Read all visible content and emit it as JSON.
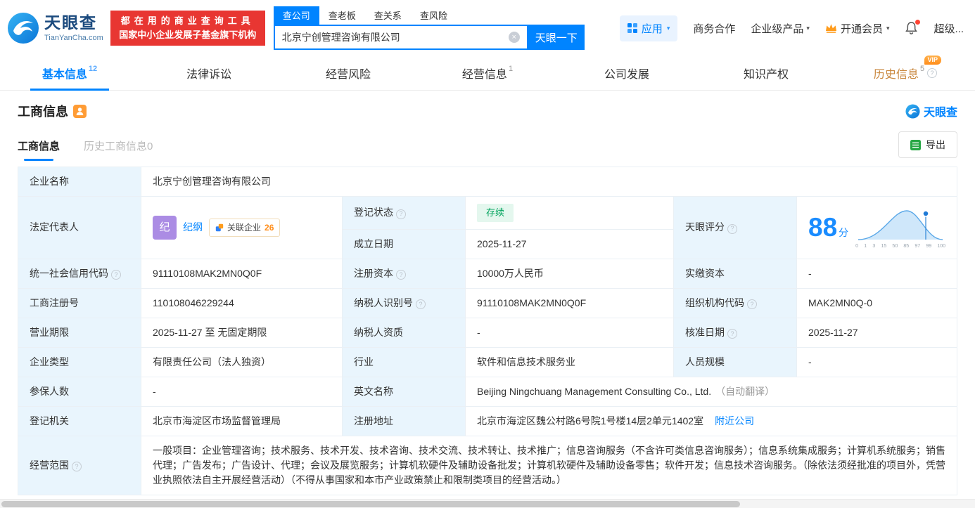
{
  "colors": {
    "brand_blue": "#0084ff",
    "slogan_red": "#e83632",
    "label_cell_bg": "#e9f5fd",
    "status_green": "#00a35c",
    "avatar_purple": "#ab8ce4",
    "vip_orange": "#ff8d1a"
  },
  "icons": {
    "help": "?",
    "caret": "▾",
    "clear": "×"
  },
  "header": {
    "logo_brand": "天眼查",
    "logo_domain": "TianYanCha.com",
    "slogan_line1": "都在用的商业查询工具",
    "slogan_line2": "国家中小企业发展子基金旗下机构",
    "search_tabs": [
      {
        "label": "查公司"
      },
      {
        "label": "查老板"
      },
      {
        "label": "查关系"
      },
      {
        "label": "查风险"
      }
    ],
    "search_value": "北京宁创管理咨询有限公司",
    "search_button": "天眼一下",
    "apps_label": "应用",
    "nav_business": "商务合作",
    "nav_enterprise": "企业级产品",
    "nav_membership": "开通会员",
    "nav_user": "超级..."
  },
  "nav_tabs": [
    {
      "label": "基本信息",
      "count": "12"
    },
    {
      "label": "法律诉讼",
      "count": ""
    },
    {
      "label": "经营风险",
      "count": ""
    },
    {
      "label": "经营信息",
      "count": "1"
    },
    {
      "label": "公司发展",
      "count": ""
    },
    {
      "label": "知识产权",
      "count": ""
    },
    {
      "label": "历史信息",
      "count": "5",
      "vip": "VIP"
    }
  ],
  "section": {
    "title": "工商信息",
    "brand_watermark": "天眼查",
    "subtab_active": "工商信息",
    "subtab_history": "历史工商信息",
    "subtab_history_count": "0",
    "export_label": "导出"
  },
  "fields": {
    "company_name_label": "企业名称",
    "company_name": "北京宁创管理咨询有限公司",
    "legal_rep_label": "法定代表人",
    "legal_rep_avatar_char": "纪",
    "legal_rep_name": "纪纲",
    "related_companies_label": "关联企业",
    "related_companies_count": "26",
    "reg_status_label": "登记状态",
    "reg_status_value": "存续",
    "score_label": "天眼评分",
    "score_value": "88",
    "score_unit": "分",
    "establish_date_label": "成立日期",
    "establish_date_value": "2025-11-27",
    "credit_code_label": "统一社会信用代码",
    "credit_code_value": "91110108MAK2MN0Q0F",
    "reg_capital_label": "注册资本",
    "reg_capital_value": "10000万人民币",
    "paid_capital_label": "实缴资本",
    "paid_capital_value": "-",
    "reg_number_label": "工商注册号",
    "reg_number_value": "110108046229244",
    "taxpayer_id_label": "纳税人识别号",
    "taxpayer_id_value": "91110108MAK2MN0Q0F",
    "org_code_label": "组织机构代码",
    "org_code_value": "MAK2MN0Q-0",
    "business_term_label": "营业期限",
    "business_term_value": "2025-11-27 至 无固定期限",
    "taxpayer_quality_label": "纳税人资质",
    "taxpayer_quality_value": "-",
    "approval_date_label": "核准日期",
    "approval_date_value": "2025-11-27",
    "company_type_label": "企业类型",
    "company_type_value": "有限责任公司（法人独资）",
    "industry_label": "行业",
    "industry_value": "软件和信息技术服务业",
    "staff_size_label": "人员规模",
    "staff_size_value": "-",
    "insured_count_label": "参保人数",
    "insured_count_value": "-",
    "english_name_label": "英文名称",
    "english_name_value": "Beijing Ningchuang Management Consulting Co., Ltd.",
    "english_name_note": "（自动翻译）",
    "reg_authority_label": "登记机关",
    "reg_authority_value": "北京市海淀区市场监督管理局",
    "reg_address_label": "注册地址",
    "reg_address_value": "北京市海淀区魏公村路6号院1号楼14层2单元1402室",
    "nearby_companies_link": "附近公司",
    "business_scope_label": "经营范围",
    "business_scope_value": "一般项目：企业管理咨询；技术服务、技术开发、技术咨询、技术交流、技术转让、技术推广；信息咨询服务（不含许可类信息咨询服务）；信息系统集成服务；计算机系统服务；销售代理；广告发布；广告设计、代理；会议及展览服务；计算机软硬件及辅助设备批发；计算机软硬件及辅助设备零售；软件开发；信息技术咨询服务。（除依法须经批准的项目外，凭营业执照依法自主开展经营活动）（不得从事国家和本市产业政策禁止和限制类项目的经营活动。）"
  },
  "score_axis": [
    "0",
    "1",
    "3",
    "15",
    "50",
    "85",
    "97",
    "99",
    "100"
  ]
}
